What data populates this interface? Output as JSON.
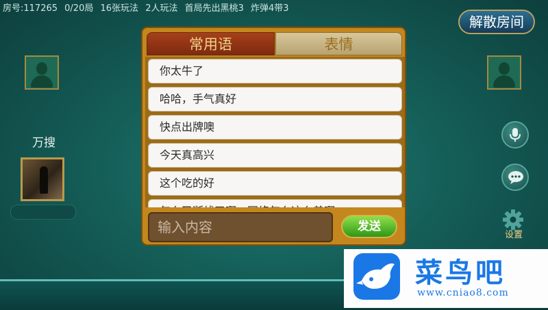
{
  "topbar": {
    "room": "房号:117265",
    "round": "0/20局",
    "rule1": "16张玩法",
    "rule2": "2人玩法",
    "rule3": "首局先出黑桃3",
    "rule4": "炸弹4带3"
  },
  "dismiss_button": "解散房间",
  "player": {
    "name": "万搜"
  },
  "chat": {
    "tabs": [
      "常用语",
      "表情"
    ],
    "active_tab": "常用语",
    "phrases": [
      "你太牛了",
      "哈哈，手气真好",
      "快点出牌噢",
      "今天真高兴",
      "这个吃的好",
      "怎么又断线了啊，网络怎么这么差啊"
    ],
    "input_placeholder": "输入内容",
    "send_label": "发送"
  },
  "side_controls": {
    "voice_icon": "microphone-icon",
    "chat_icon": "chat-bubble-icon",
    "settings_icon": "gear-icon",
    "settings_label": "设置"
  },
  "watermark": {
    "title": "菜鸟吧",
    "url": "www.cniao8.com"
  },
  "colors": {
    "table_green": "#1f7b73",
    "panel_gold": "#c4871d",
    "active_tab": "#a6401a",
    "send_green": "#2e9716",
    "watermark_blue": "#1a78e6"
  }
}
